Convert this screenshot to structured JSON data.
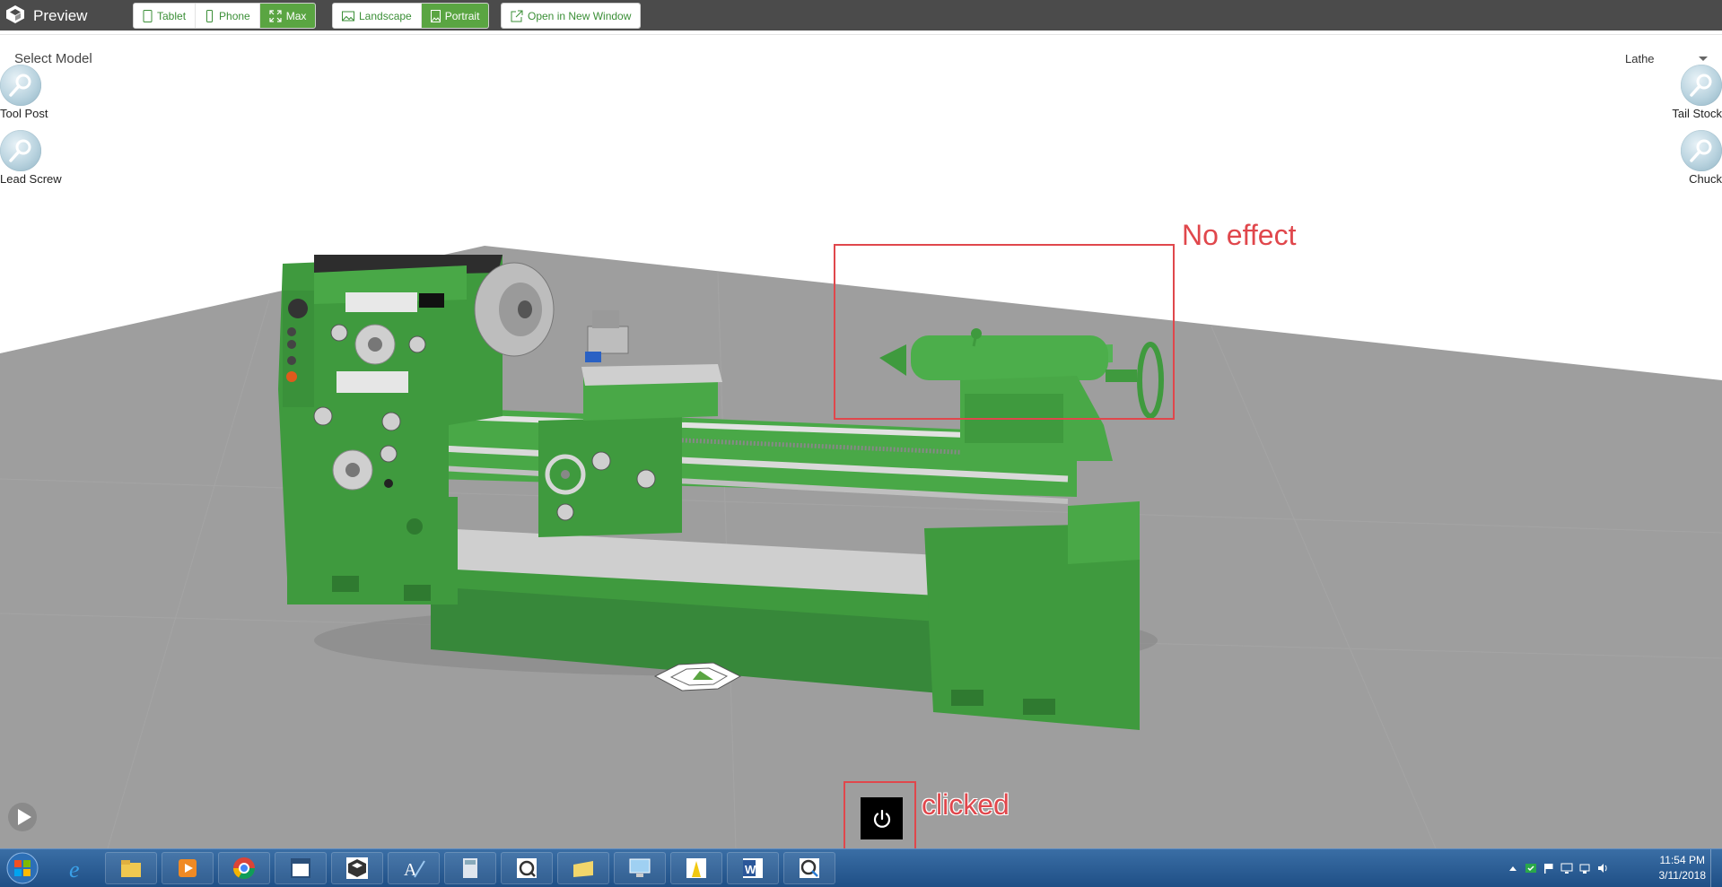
{
  "app": {
    "title": "Preview"
  },
  "toolbar": {
    "device_buttons": [
      {
        "label": "Tablet",
        "icon": "tablet-icon",
        "active": false
      },
      {
        "label": "Phone",
        "icon": "phone-icon",
        "active": false
      },
      {
        "label": "Max",
        "icon": "maximize-icon",
        "active": true
      }
    ],
    "orientation_buttons": [
      {
        "label": "Landscape",
        "icon": "landscape-icon",
        "active": false
      },
      {
        "label": "Portrait",
        "icon": "portrait-icon",
        "active": true
      }
    ],
    "open_window_label": "Open in New Window",
    "accent_color": "#5aa542"
  },
  "scene": {
    "select_label": "Select Model",
    "model_selected": "Lathe",
    "hotspots_left": [
      "Tool Post",
      "Lead Screw"
    ],
    "hotspots_right": [
      "Tail Stock",
      "Chuck"
    ],
    "machine_color": "#3f9a3e",
    "floor_color": "#9e9e9e"
  },
  "annotations": {
    "no_effect": "No effect",
    "clicked": "clicked",
    "color": "#e0474c"
  },
  "taskbar": {
    "apps": [
      "internet-explorer-icon",
      "file-explorer-icon",
      "media-player-icon",
      "chrome-icon",
      "window-icon",
      "vuforia-studio-icon",
      "text-editor-icon",
      "calculator-icon",
      "qlik-icon",
      "folder-icon",
      "remote-desktop-icon",
      "powerbi-icon",
      "word-icon",
      "qlik-view-icon"
    ],
    "time": "11:54 PM",
    "date": "3/11/2018"
  }
}
